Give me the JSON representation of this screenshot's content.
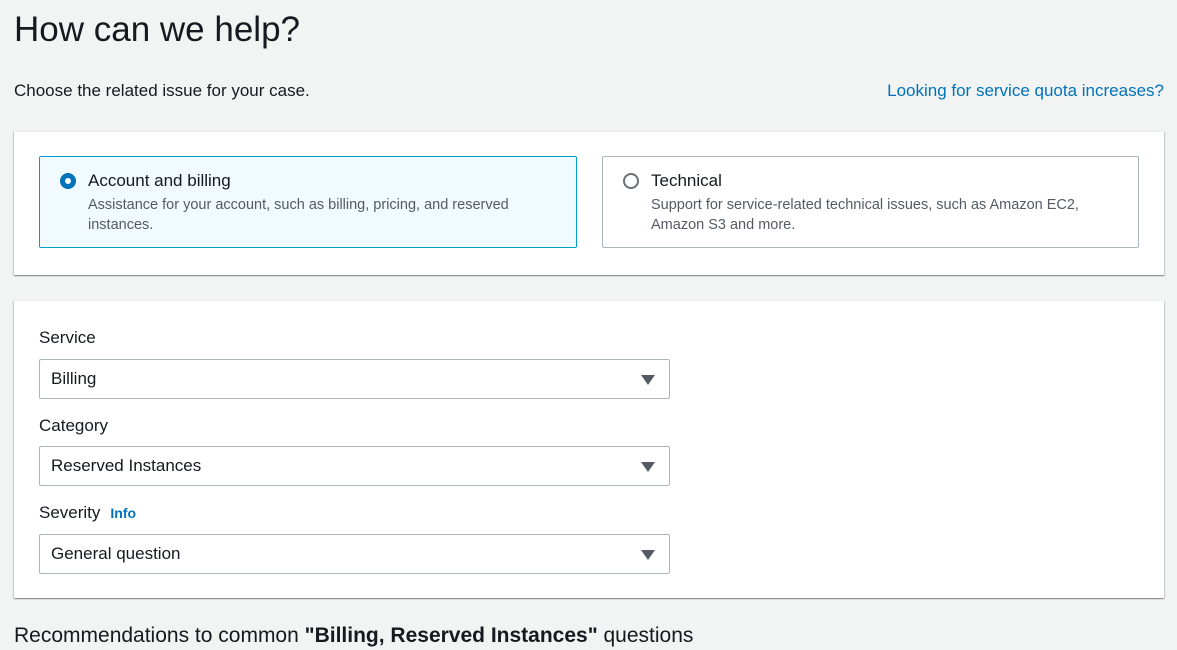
{
  "page": {
    "title": "How can we help?",
    "description": "Choose the related issue for your case.",
    "quota_link": "Looking for service quota increases?"
  },
  "issue_types": [
    {
      "title": "Account and billing",
      "description": "Assistance for your account, such as billing, pricing, and reserved instances.",
      "selected": true
    },
    {
      "title": "Technical",
      "description": "Support for service-related technical issues, such as Amazon EC2, Amazon S3 and more.",
      "selected": false
    }
  ],
  "form": {
    "service": {
      "label": "Service",
      "value": "Billing"
    },
    "category": {
      "label": "Category",
      "value": "Reserved Instances"
    },
    "severity": {
      "label": "Severity",
      "info": "Info",
      "value": "General question"
    }
  },
  "recommendations": {
    "prefix": "Recommendations to common ",
    "topic": "\"Billing, Reserved Instances\"",
    "suffix": " questions"
  },
  "colors": {
    "accent": "#0073bb",
    "selected_border": "#00a1c9",
    "selected_bg": "#f1faff",
    "page_bg": "#f2f3f3"
  }
}
